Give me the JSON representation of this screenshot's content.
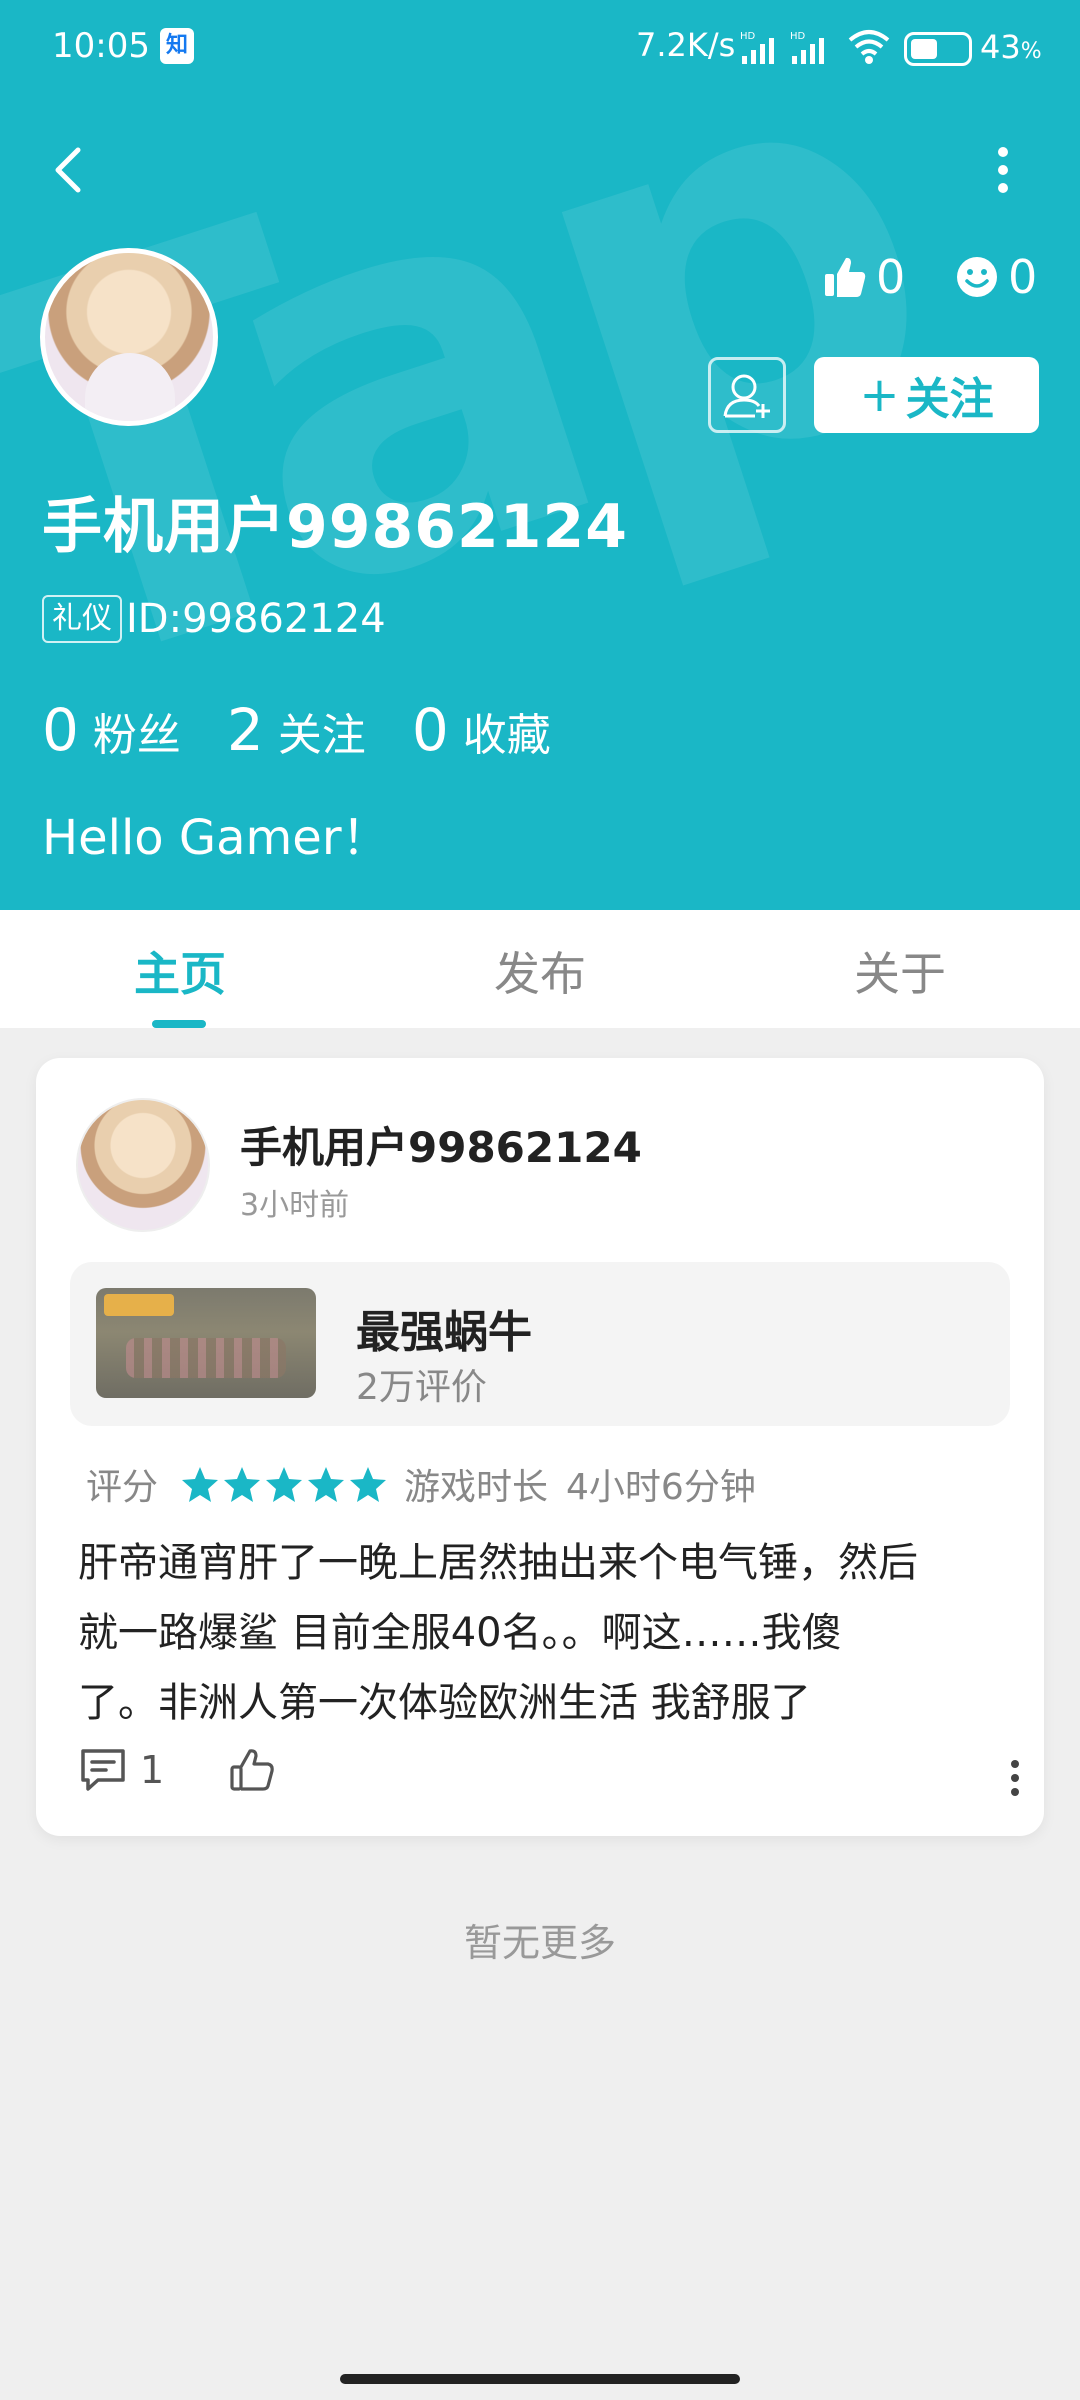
{
  "status_bar": {
    "time": "10:05",
    "app_badge": "知",
    "net_speed": "7.2K/s",
    "battery_pct": "43",
    "battery_unit": "%"
  },
  "header": {
    "like_count": "0",
    "smile_count": "0",
    "follow_label": "关注",
    "follow_plus": "+",
    "username": "手机用户99862124",
    "badge": "礼仪",
    "user_id": "ID:99862124",
    "counts": [
      {
        "num": "0",
        "label": "粉丝"
      },
      {
        "num": "2",
        "label": "关注"
      },
      {
        "num": "0",
        "label": "收藏"
      }
    ],
    "bio": "Hello Gamer！"
  },
  "tabs": [
    {
      "label": "主页",
      "active": true
    },
    {
      "label": "发布",
      "active": false
    },
    {
      "label": "关于",
      "active": false
    }
  ],
  "post": {
    "author": "手机用户99862124",
    "time": "3小时前",
    "game": {
      "name": "最强蜗牛",
      "reviews": "2万评价"
    },
    "rating_label": "评分",
    "rating_stars": 5,
    "playtime_label": "游戏时长",
    "playtime": "4小时6分钟",
    "text_lines": [
      "肝帝通宵肝了一晚上居然抽出来个电气锤，然后",
      "就一路爆鲨 目前全服40名。。啊这……我傻",
      "了。非洲人第一次体验欧洲生活 我舒服了"
    ],
    "comment_count": "1"
  },
  "footer": {
    "no_more": "暂无更多"
  },
  "colors": {
    "accent": "#1ab7c6",
    "background": "#efefef",
    "card": "#ffffff"
  },
  "icons": {
    "back": "chevron-left-icon",
    "more": "more-vertical-icon",
    "like": "thumbs-up-icon",
    "smile": "smile-icon",
    "add_friend": "add-user-icon",
    "star": "star-icon",
    "comment": "comment-icon"
  }
}
